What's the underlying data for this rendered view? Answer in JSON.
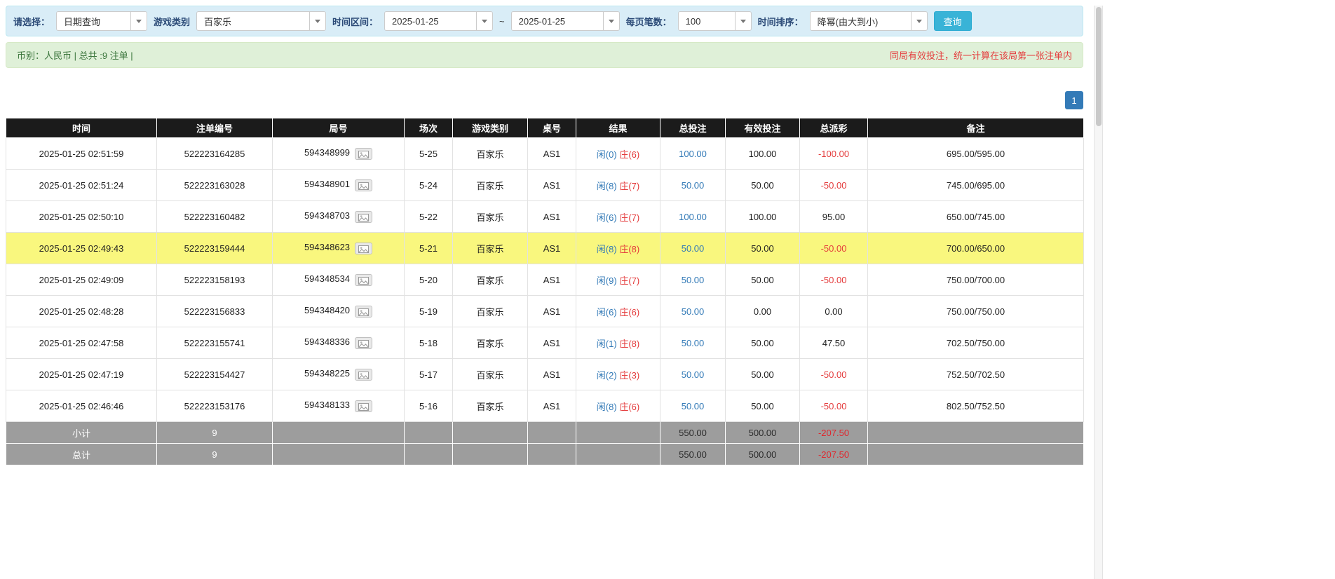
{
  "filters": {
    "select_label": "请选择：",
    "select_value": "日期查询",
    "game_type_label": "游戏类别",
    "game_type_value": "百家乐",
    "date_range_label": "时间区间：",
    "date_from": "2025-01-25",
    "tilde": "~",
    "date_to": "2025-01-25",
    "page_size_label": "每页笔数：",
    "page_size_value": "100",
    "sort_label": "时间排序：",
    "sort_value": "降幂(由大到小)",
    "search_button": "查询"
  },
  "summary": {
    "left": "币别：人民币 | 总共 :9 注单 |",
    "right_note": "同局有效投注，统一计算在该局第一张注单内"
  },
  "pagination": {
    "page": "1"
  },
  "table": {
    "headers": [
      "时间",
      "注单编号",
      "局号",
      "场次",
      "游戏类别",
      "桌号",
      "结果",
      "总投注",
      "有效投注",
      "总派彩",
      "备注"
    ],
    "rows": [
      {
        "time": "2025-01-25 02:51:59",
        "bet_id": "522223164285",
        "round_id": "594348999",
        "session": "5-25",
        "game": "百家乐",
        "table": "AS1",
        "result_player": "闲(0)",
        "result_banker": "庄(6)",
        "total_bet": "100.00",
        "valid_bet": "100.00",
        "payout": "-100.00",
        "note": "695.00/595.00",
        "highlighted": false
      },
      {
        "time": "2025-01-25 02:51:24",
        "bet_id": "522223163028",
        "round_id": "594348901",
        "session": "5-24",
        "game": "百家乐",
        "table": "AS1",
        "result_player": "闲(8)",
        "result_banker": "庄(7)",
        "total_bet": "50.00",
        "valid_bet": "50.00",
        "payout": "-50.00",
        "note": "745.00/695.00",
        "highlighted": false
      },
      {
        "time": "2025-01-25 02:50:10",
        "bet_id": "522223160482",
        "round_id": "594348703",
        "session": "5-22",
        "game": "百家乐",
        "table": "AS1",
        "result_player": "闲(6)",
        "result_banker": "庄(7)",
        "total_bet": "100.00",
        "valid_bet": "100.00",
        "payout": "95.00",
        "note": "650.00/745.00",
        "highlighted": false
      },
      {
        "time": "2025-01-25 02:49:43",
        "bet_id": "522223159444",
        "round_id": "594348623",
        "session": "5-21",
        "game": "百家乐",
        "table": "AS1",
        "result_player": "闲(8)",
        "result_banker": "庄(8)",
        "total_bet": "50.00",
        "valid_bet": "50.00",
        "payout": "-50.00",
        "note": "700.00/650.00",
        "highlighted": true
      },
      {
        "time": "2025-01-25 02:49:09",
        "bet_id": "522223158193",
        "round_id": "594348534",
        "session": "5-20",
        "game": "百家乐",
        "table": "AS1",
        "result_player": "闲(9)",
        "result_banker": "庄(7)",
        "total_bet": "50.00",
        "valid_bet": "50.00",
        "payout": "-50.00",
        "note": "750.00/700.00",
        "highlighted": false
      },
      {
        "time": "2025-01-25 02:48:28",
        "bet_id": "522223156833",
        "round_id": "594348420",
        "session": "5-19",
        "game": "百家乐",
        "table": "AS1",
        "result_player": "闲(6)",
        "result_banker": "庄(6)",
        "total_bet": "50.00",
        "valid_bet": "0.00",
        "payout": "0.00",
        "note": "750.00/750.00",
        "highlighted": false
      },
      {
        "time": "2025-01-25 02:47:58",
        "bet_id": "522223155741",
        "round_id": "594348336",
        "session": "5-18",
        "game": "百家乐",
        "table": "AS1",
        "result_player": "闲(1)",
        "result_banker": "庄(8)",
        "total_bet": "50.00",
        "valid_bet": "50.00",
        "payout": "47.50",
        "note": "702.50/750.00",
        "highlighted": false
      },
      {
        "time": "2025-01-25 02:47:19",
        "bet_id": "522223154427",
        "round_id": "594348225",
        "session": "5-17",
        "game": "百家乐",
        "table": "AS1",
        "result_player": "闲(2)",
        "result_banker": "庄(3)",
        "total_bet": "50.00",
        "valid_bet": "50.00",
        "payout": "-50.00",
        "note": "752.50/702.50",
        "highlighted": false
      },
      {
        "time": "2025-01-25 02:46:46",
        "bet_id": "522223153176",
        "round_id": "594348133",
        "session": "5-16",
        "game": "百家乐",
        "table": "AS1",
        "result_player": "闲(8)",
        "result_banker": "庄(6)",
        "total_bet": "50.00",
        "valid_bet": "50.00",
        "payout": "-50.00",
        "note": "802.50/752.50",
        "highlighted": false
      }
    ],
    "subtotal": {
      "label": "小计",
      "count": "9",
      "total_bet": "550.00",
      "valid_bet": "500.00",
      "payout": "-207.50"
    },
    "total": {
      "label": "总计",
      "count": "9",
      "total_bet": "550.00",
      "valid_bet": "500.00",
      "payout": "-207.50"
    }
  },
  "colors": {
    "filter_bar_bg": "#d9edf7",
    "summary_bar_bg": "#dff0d8",
    "search_button_bg": "#39b3d7",
    "pagination_bg": "#337ab7",
    "header_bg": "#1b1b1b",
    "footer_bg": "#9d9d9d",
    "highlight_row_bg": "#f9f77e",
    "player_blue": "#337ab7",
    "banker_red": "#e43b3c",
    "negative_red": "#e43b3c"
  }
}
